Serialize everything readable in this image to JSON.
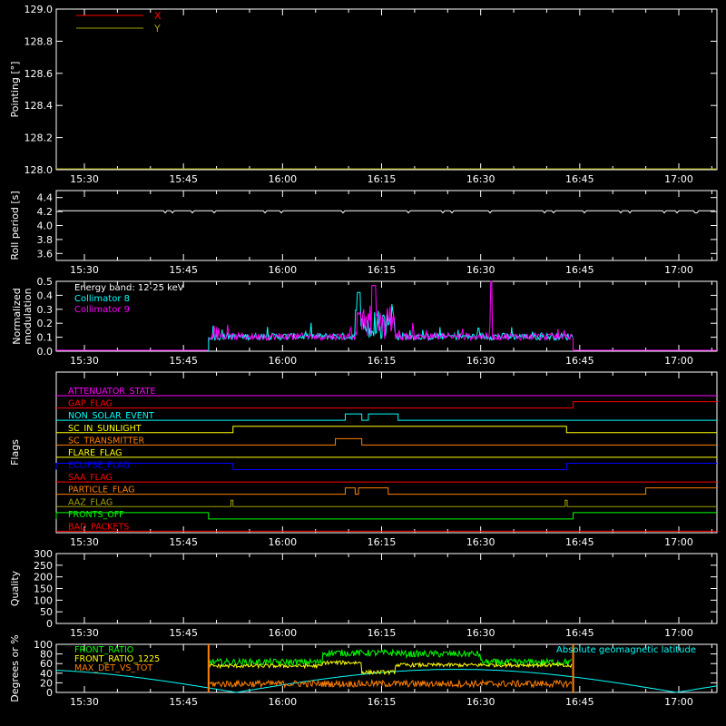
{
  "x_axis": {
    "ticks": [
      "15:30",
      "15:45",
      "16:00",
      "16:15",
      "16:30",
      "16:45",
      "17:00"
    ],
    "range_minutes": [
      15.5,
      65.0
    ],
    "tick_minutes": [
      20,
      35,
      50,
      65,
      80,
      95,
      110
    ]
  },
  "colors": {
    "x": "#ff0000",
    "y": "#a0a000",
    "roll": "#ffffff",
    "cyan": "#00ffff",
    "magenta": "#ff00ff",
    "green": "#00ff00",
    "yellow": "#ffff00",
    "orange": "#ff8000",
    "red": "#ff0000",
    "blue": "#0000ff",
    "olive": "#a0a000",
    "lightgreen": "#00ff00"
  },
  "chart_data": [
    {
      "type": "line",
      "id": "pointing",
      "ylabel": "Pointing [°]",
      "ylim": [
        128.0,
        129.0
      ],
      "yticks": [
        "128.0",
        "128.2",
        "128.4",
        "128.6",
        "128.8",
        "129.0"
      ],
      "series": [
        {
          "name": "X",
          "color": "#ff0000"
        },
        {
          "name": "Y",
          "color": "#a0a000"
        }
      ],
      "baseline": 128.0
    },
    {
      "type": "line",
      "id": "roll",
      "ylabel": "Roll period [s]",
      "ylim": [
        3.5,
        4.5
      ],
      "yticks": [
        "3.6",
        "3.8",
        "4.0",
        "4.2",
        "4.4"
      ],
      "value": 4.21
    },
    {
      "type": "line",
      "id": "modulation",
      "ylabel": [
        "Normalized",
        "modulation"
      ],
      "ylim": [
        0,
        0.5
      ],
      "yticks": [
        "0.0",
        "0.1",
        "0.2",
        "0.3",
        "0.4",
        "0.5"
      ],
      "legend": [
        "Energy band: 12-25 keV",
        "Collimator 8",
        "Collimator 9"
      ],
      "start_minute": 38.8,
      "end_minute": 94.0,
      "baseline": 0.1
    },
    {
      "type": "table",
      "id": "flags",
      "ylabel": "Flags",
      "rows": [
        {
          "label": "ATTENUATOR_STATE",
          "color": "#ff00ff",
          "high": []
        },
        {
          "label": "GAP_FLAG",
          "color": "#ff0000",
          "high": [
            [
              94.0,
              125
            ]
          ]
        },
        {
          "label": "NON_SOLAR_EVENT",
          "color": "#00ffff",
          "high": [
            [
              59.5,
              62.0
            ],
            [
              63.0,
              67.5
            ]
          ]
        },
        {
          "label": "SC_IN_SUNLIGHT",
          "color": "#ffff00",
          "high": [
            [
              42.5,
              93.0
            ]
          ]
        },
        {
          "label": "SC_TRANSMITTER",
          "color": "#ff8000",
          "high": [
            [
              58.0,
              62.0
            ]
          ]
        },
        {
          "label": "FLARE_FLAG",
          "color": "#ffff00",
          "high": []
        },
        {
          "label": "ECLIPSE_FLAG",
          "color": "#0000ff",
          "high": [
            [
              0,
              42.5
            ],
            [
              93.0,
              125
            ]
          ]
        },
        {
          "label": "SAA_FLAG",
          "color": "#ff0000",
          "high": []
        },
        {
          "label": "PARTICLE_FLAG",
          "color": "#ff8000",
          "high": [
            [
              59.5,
              61.0
            ],
            [
              61.5,
              66.0
            ],
            [
              105.0,
              125
            ]
          ]
        },
        {
          "label": "AAZ_FLAG",
          "color": "#a0a000",
          "high": [
            [
              42.2,
              42.5
            ],
            [
              92.8,
              93.1
            ]
          ]
        },
        {
          "label": "FRONTS_OFF",
          "color": "#00ff00",
          "high": [
            [
              0,
              38.8
            ],
            [
              94.0,
              125
            ]
          ]
        },
        {
          "label": "BAD_PACKETS",
          "color": "#ff0000",
          "high": []
        }
      ]
    },
    {
      "type": "line",
      "id": "quality",
      "ylabel": "Quality",
      "ylim": [
        0,
        300
      ],
      "yticks": [
        "0",
        "50",
        "100",
        "150",
        "200",
        "250",
        "300"
      ]
    },
    {
      "type": "line",
      "id": "ratios",
      "ylabel": "Degrees or %",
      "ylim": [
        0,
        100
      ],
      "yticks": [
        "0",
        "20",
        "40",
        "60",
        "80",
        "100"
      ],
      "series": [
        {
          "name": "FRONT_RATIO",
          "color": "#00ff00"
        },
        {
          "name": "FRONT_RATIO_1225",
          "color": "#ffff00"
        },
        {
          "name": "MAX_DET_VS_TOT",
          "color": "#ff8000"
        },
        {
          "name": "Absolute geomagnetic latitude",
          "color": "#00ffff"
        }
      ],
      "start_minute": 38.8,
      "end_minute": 94.0
    }
  ]
}
